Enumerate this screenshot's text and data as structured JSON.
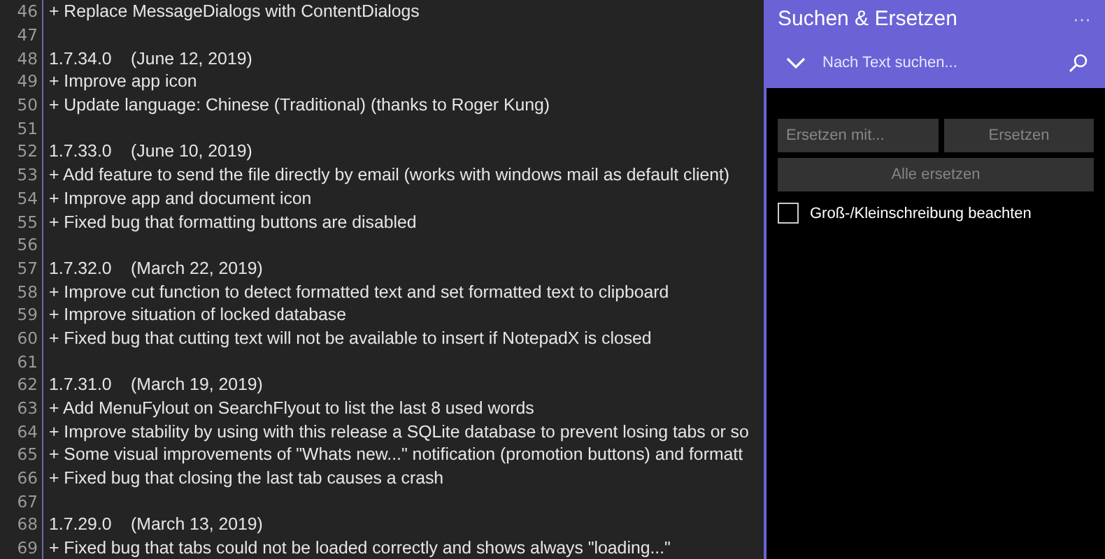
{
  "editor": {
    "lines": [
      {
        "number": "46",
        "text": "+ Replace MessageDialogs with ContentDialogs"
      },
      {
        "number": "47"
      },
      {
        "number": "48",
        "text": "1.7.34.0    (June 12, 2019)"
      },
      {
        "number": "49",
        "text": "+ Improve app icon"
      },
      {
        "number": "50",
        "text": "+ Update language: Chinese (Traditional) (thanks to Roger Kung)"
      },
      {
        "number": "51"
      },
      {
        "number": "52",
        "text": "1.7.33.0    (June 10, 2019)"
      },
      {
        "number": "53",
        "text": "+ Add feature to send the file directly by email (works with windows mail as default client)"
      },
      {
        "number": "54",
        "text": "+ Improve app and document icon"
      },
      {
        "number": "55",
        "text": "+ Fixed bug that formatting buttons are disabled"
      },
      {
        "number": "56"
      },
      {
        "number": "57",
        "text": "1.7.32.0    (March 22, 2019)"
      },
      {
        "number": "58",
        "text": "+ Improve cut function to detect formatted text and set formatted text to clipboard"
      },
      {
        "number": "59",
        "text": "+ Improve situation of locked database"
      },
      {
        "number": "60",
        "text": "+ Fixed bug that cutting text will not be available to insert if NotepadX is closed"
      },
      {
        "number": "61"
      },
      {
        "number": "62",
        "text": "1.7.31.0    (March 19, 2019)"
      },
      {
        "number": "63",
        "text": "+ Add MenuFylout on SearchFlyout to list the last 8 used words"
      },
      {
        "number": "64",
        "text": "+ Improve stability by using with this release a SQLite database to prevent losing tabs or so"
      },
      {
        "number": "65",
        "text": "+ Some visual improvements of \"Whats new...\" notification (promotion buttons) and formatt"
      },
      {
        "number": "66",
        "text": "+ Fixed bug that closing the last tab causes a crash"
      },
      {
        "number": "67"
      },
      {
        "number": "68",
        "text": "1.7.29.0    (March 13, 2019)"
      },
      {
        "number": "69",
        "text": "+ Fixed bug that tabs could not be loaded correctly and shows always \"loading...\""
      }
    ]
  },
  "panel": {
    "title": "Suchen & Ersetzen",
    "more": "···",
    "search": {
      "placeholder": "Nach Text suchen..."
    },
    "replace": {
      "placeholder": "Ersetzen mit..."
    },
    "buttons": [
      {
        "label": "Ersetzen",
        "disabled": true
      },
      {
        "label": "Alle ersetzen",
        "disabled": true
      }
    ],
    "checkbox": {
      "label": "Groß-/Kleinschreibung beachten",
      "checked": false
    }
  }
}
